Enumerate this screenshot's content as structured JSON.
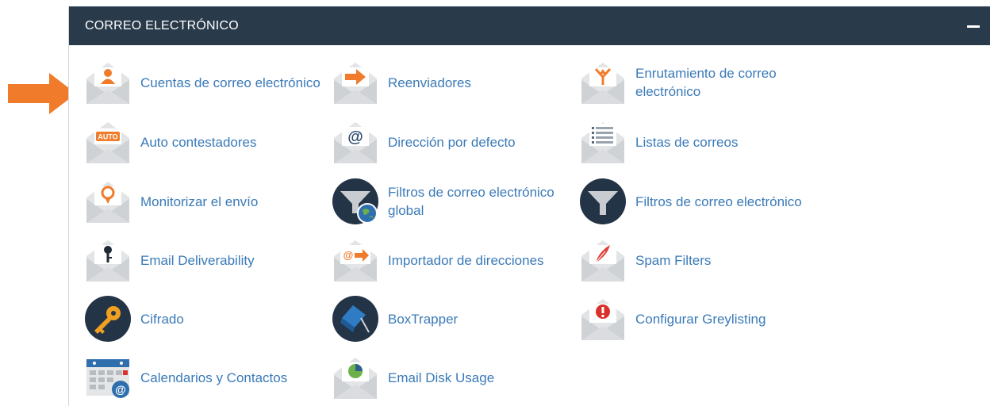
{
  "panel": {
    "title": "CORREO ELECTRÓNICO",
    "collapse_symbol": "—",
    "items": [
      {
        "label": "Cuentas de correo electrónico",
        "icon": "email-accounts-icon"
      },
      {
        "label": "Reenviadores",
        "icon": "forwarders-icon"
      },
      {
        "label": "Enrutamiento de correo electrónico",
        "icon": "email-routing-icon"
      },
      {
        "label": "Auto contestadores",
        "icon": "autoresponders-icon",
        "icon_text": "AUTO"
      },
      {
        "label": "Dirección por defecto",
        "icon": "default-address-icon",
        "icon_text": "@"
      },
      {
        "label": "Listas de correos",
        "icon": "mailing-lists-icon"
      },
      {
        "label": "Monitorizar el envío",
        "icon": "track-delivery-icon"
      },
      {
        "label": "Filtros de correo electrónico global",
        "icon": "global-email-filters-icon"
      },
      {
        "label": "Filtros de correo electrónico",
        "icon": "email-filters-icon"
      },
      {
        "label": "Email Deliverability",
        "icon": "email-deliverability-icon"
      },
      {
        "label": "Importador de direcciones",
        "icon": "address-importer-icon",
        "icon_text": "@"
      },
      {
        "label": "Spam Filters",
        "icon": "spam-filters-icon"
      },
      {
        "label": "Cifrado",
        "icon": "encryption-icon"
      },
      {
        "label": "BoxTrapper",
        "icon": "boxtrapper-icon"
      },
      {
        "label": "Configurar Greylisting",
        "icon": "greylisting-icon"
      },
      {
        "label": "Calendarios y Contactos",
        "icon": "calendars-contacts-icon",
        "icon_text": "@"
      },
      {
        "label": "Email Disk Usage",
        "icon": "email-disk-usage-icon"
      }
    ]
  },
  "colors": {
    "header_bg": "#293a4a",
    "link": "#3a7ab8",
    "accent_orange": "#f07c2b",
    "envelope_gray": "#d9dbdd",
    "dark_circle": "#243447"
  }
}
